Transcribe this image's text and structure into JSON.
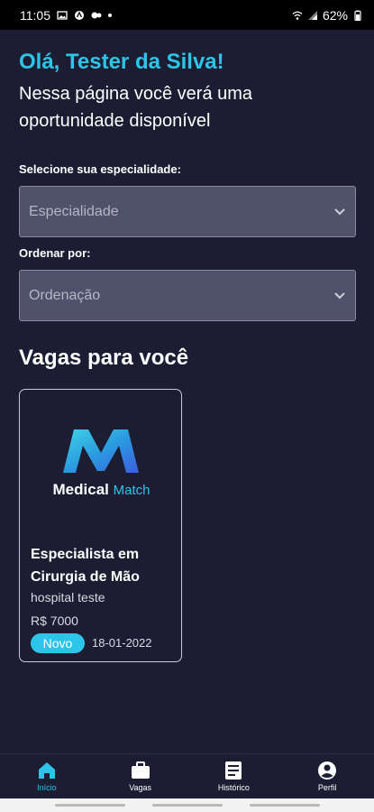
{
  "status_bar": {
    "time": "11:05",
    "battery": "62%"
  },
  "header": {
    "greeting": "Olá, Tester da Silva!",
    "subtitle": "Nessa página você verá uma oportunidade disponível"
  },
  "filters": {
    "specialty_label": "Selecione sua especialidade:",
    "specialty_placeholder": "Especialidade",
    "order_label": "Ordenar por:",
    "order_placeholder": "Ordenação"
  },
  "section": {
    "title": "Vagas para você"
  },
  "jobs": [
    {
      "logo_word1": "Medical",
      "logo_word2": "Match",
      "title": "Especialista em Cirurgia de Mão",
      "hospital": "hospital teste",
      "price": "R$ 7000",
      "badge": "Novo",
      "date": "18-01-2022"
    }
  ],
  "nav": {
    "items": [
      {
        "label": "Início",
        "icon": "home-icon",
        "active": true
      },
      {
        "label": "Vagas",
        "icon": "briefcase-icon",
        "active": false
      },
      {
        "label": "Histórico",
        "icon": "document-icon",
        "active": false
      },
      {
        "label": "Perfil",
        "icon": "profile-icon",
        "active": false
      }
    ]
  },
  "colors": {
    "background": "#1c1d33",
    "accent": "#2ec4e8",
    "select_bg": "#50526c"
  }
}
